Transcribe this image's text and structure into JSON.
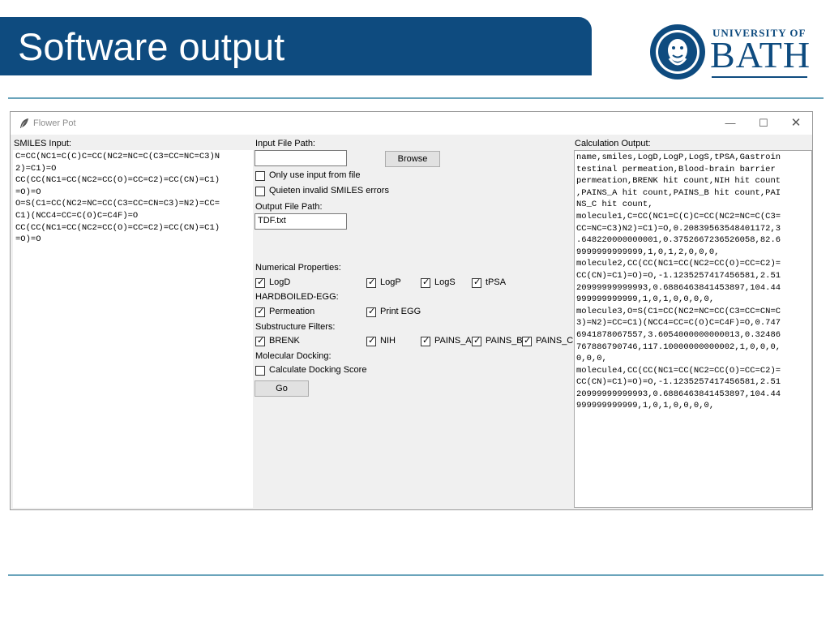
{
  "slide": {
    "title": "Software output",
    "logo": {
      "line1": "UNIVERSITY OF",
      "line2": "BATH"
    }
  },
  "window": {
    "title": "Flower Pot",
    "controls": {
      "minimize": "—",
      "maximize": "☐",
      "close": "✕"
    }
  },
  "smiles": {
    "label": "SMILES Input:",
    "value": "C=CC(NC1=C(C)C=CC(NC2=NC=C(C3=CC=NC=C3)N\n2)=C1)=O\nCC(CC(NC1=CC(NC2=CC(O)=CC=C2)=CC(CN)=C1)\n=O)=O\nO=S(C1=CC(NC2=NC=CC(C3=CC=CN=C3)=N2)=CC=\nC1)(NCC4=CC=C(O)C=C4F)=O\nCC(CC(NC1=CC(NC2=CC(O)=CC=C2)=CC(CN)=C1)\n=O)=O"
  },
  "input_file": {
    "label": "Input File Path:",
    "value": "",
    "browse": "Browse",
    "only_use_file": {
      "label": "Only use input from file",
      "checked": false
    },
    "quieten": {
      "label": "Quieten invalid SMILES errors",
      "checked": false
    }
  },
  "output_file": {
    "label": "Output File Path:",
    "value": "TDF.txt"
  },
  "numerical": {
    "label": "Numerical Properties:",
    "logd": {
      "label": "LogD",
      "checked": true
    },
    "logp": {
      "label": "LogP",
      "checked": true
    },
    "logs": {
      "label": "LogS",
      "checked": true
    },
    "tpsa": {
      "label": "tPSA",
      "checked": true
    }
  },
  "egg": {
    "label": "HARDBOILED-EGG:",
    "permeation": {
      "label": "Permeation",
      "checked": true
    },
    "print_egg": {
      "label": "Print EGG",
      "checked": true
    }
  },
  "filters": {
    "label": "Substructure Filters:",
    "brenk": {
      "label": "BRENK",
      "checked": true
    },
    "nih": {
      "label": "NIH",
      "checked": true
    },
    "pains_a": {
      "label": "PAINS_A",
      "checked": true
    },
    "pains_b": {
      "label": "PAINS_B",
      "checked": true
    },
    "pains_c": {
      "label": "PAINS_C",
      "checked": true
    }
  },
  "docking": {
    "label": "Molecular Docking:",
    "calc": {
      "label": "Calculate Docking Score",
      "checked": false
    }
  },
  "go_button": "Go",
  "output": {
    "label": "Calculation Output:",
    "value": "name,smiles,LogD,LogP,LogS,tPSA,Gastroin\ntestinal permeation,Blood-brain barrier\npermeation,BRENK hit count,NIH hit count\n,PAINS_A hit count,PAINS_B hit count,PAI\nNS_C hit count,\nmolecule1,C=CC(NC1=C(C)C=CC(NC2=NC=C(C3=\nCC=NC=C3)N2)=C1)=O,0.20839563548401172,3\n.648220000000001,0.3752667236526058,82.6\n9999999999999,1,0,1,2,0,0,0,\nmolecule2,CC(CC(NC1=CC(NC2=CC(O)=CC=C2)=\nCC(CN)=C1)=O)=O,-1.1235257417456581,2.51\n20999999999993,0.6886463841453897,104.44\n999999999999,1,0,1,0,0,0,0,\nmolecule3,O=S(C1=CC(NC2=NC=CC(C3=CC=CN=C\n3)=N2)=CC=C1)(NCC4=CC=C(O)C=C4F)=O,0.747\n6941878067557,3.6054000000000013,0.32486\n767886790746,117.10000000000002,1,0,0,0,\n0,0,0,\nmolecule4,CC(CC(NC1=CC(NC2=CC(O)=CC=C2)=\nCC(CN)=C1)=O)=O,-1.1235257417456581,2.51\n20999999999993,0.6886463841453897,104.44\n999999999999,1,0,1,0,0,0,0,"
  }
}
